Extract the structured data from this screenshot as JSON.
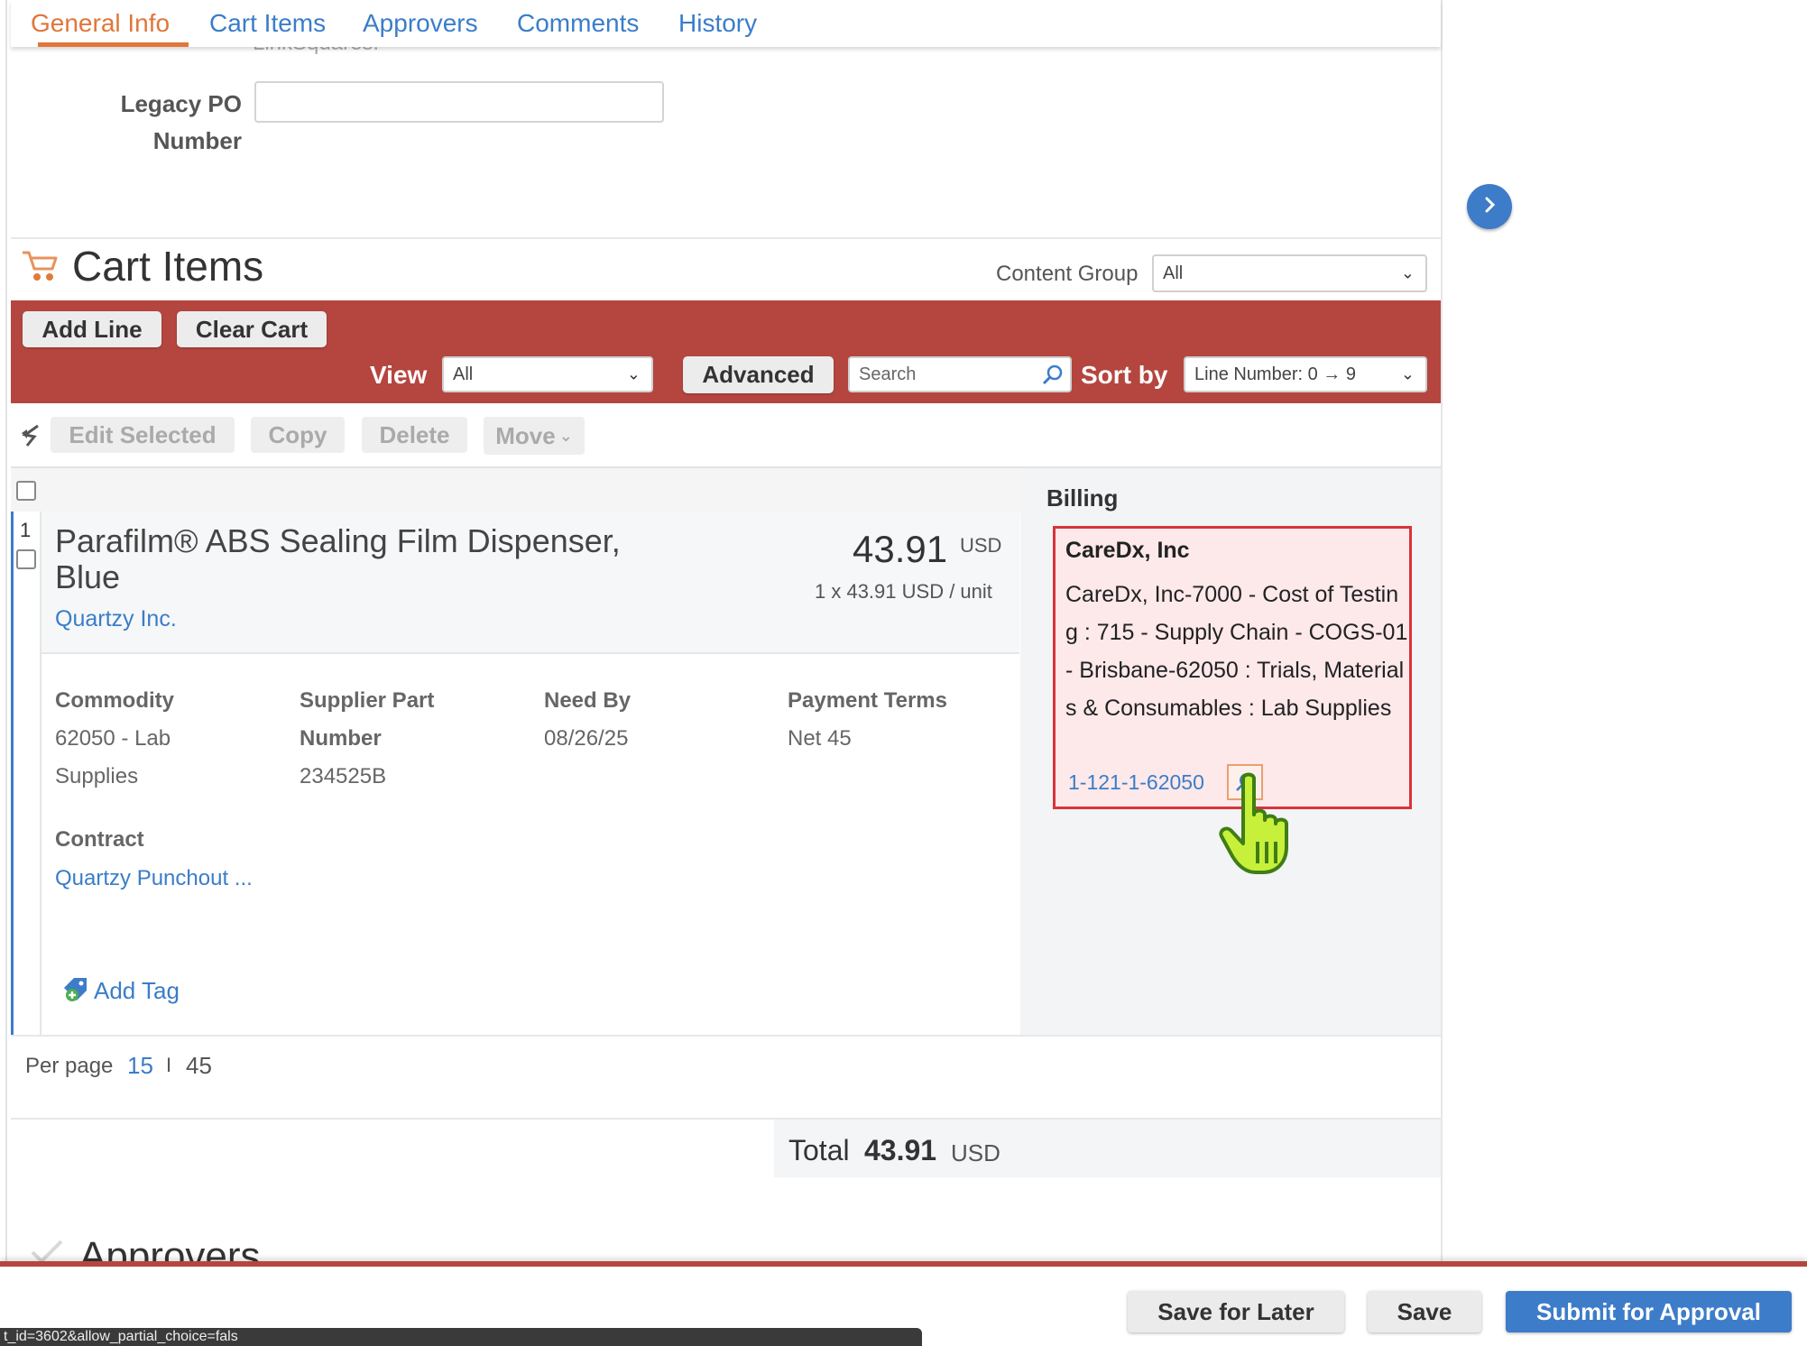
{
  "tabs": [
    {
      "label": "General Info",
      "active": true
    },
    {
      "label": "Cart Items"
    },
    {
      "label": "Approvers"
    },
    {
      "label": "Comments"
    },
    {
      "label": "History"
    }
  ],
  "ghost_text": "LinkSquares.",
  "legacy_po": {
    "label_line1": "Legacy PO",
    "label_line2": "Number",
    "value": ""
  },
  "cart": {
    "title": "Cart Items",
    "content_group_label": "Content Group",
    "content_group_value": "All",
    "add_line": "Add Line",
    "clear_cart": "Clear Cart",
    "view_label": "View",
    "view_value": "All",
    "advanced": "Advanced",
    "search_placeholder": "Search",
    "sort_label": "Sort by",
    "sort_value": "Line Number: 0 → 9",
    "actions": {
      "edit_selected": "Edit Selected",
      "copy": "Copy",
      "delete": "Delete",
      "move": "Move"
    }
  },
  "billing_header": "Billing",
  "item": {
    "line_number": "1",
    "name": "Parafilm® ABS Sealing Film Dispenser, Blue",
    "supplier": "Quartzy Inc.",
    "price": "43.91",
    "currency": "USD",
    "unit_price_text": "1 x 43.91 USD / unit",
    "commodity_label": "Commodity",
    "commodity_line1": "62050 - Lab",
    "commodity_line2": "Supplies",
    "supplier_part_label_1": "Supplier Part",
    "supplier_part_label_2": "Number",
    "supplier_part_value": "234525B",
    "need_by_label": "Need By",
    "need_by_value": "08/26/25",
    "payment_terms_label": "Payment Terms",
    "payment_terms_value": "Net 45",
    "contract_label": "Contract",
    "contract_value": "Quartzy Punchout ...",
    "add_tag": "Add Tag"
  },
  "billing": {
    "company": "CareDx, Inc",
    "description": "CareDx, Inc-7000 - Cost of Testing : 715 - Supply Chain - COGS-01 - Brisbane-62050 : Trials, Materials & Consumables : Lab Supplies",
    "code": "1-121-1-62050"
  },
  "pagination": {
    "per_page_label": "Per page",
    "option_15": "15",
    "separator": "I",
    "option_45": "45"
  },
  "totals": {
    "label": "Total",
    "amount": "43.91",
    "currency": "USD"
  },
  "approvers_title": "Approvers",
  "footer": {
    "save_for_later": "Save for Later",
    "save": "Save",
    "submit": "Submit for Approval"
  },
  "status_url": "t_id=3602&allow_partial_choice=fals",
  "colors": {
    "accent_red": "#b5463f",
    "link_blue": "#3a7dc9",
    "active_tab": "#e0763a",
    "primary_button": "#3d7cc9"
  }
}
